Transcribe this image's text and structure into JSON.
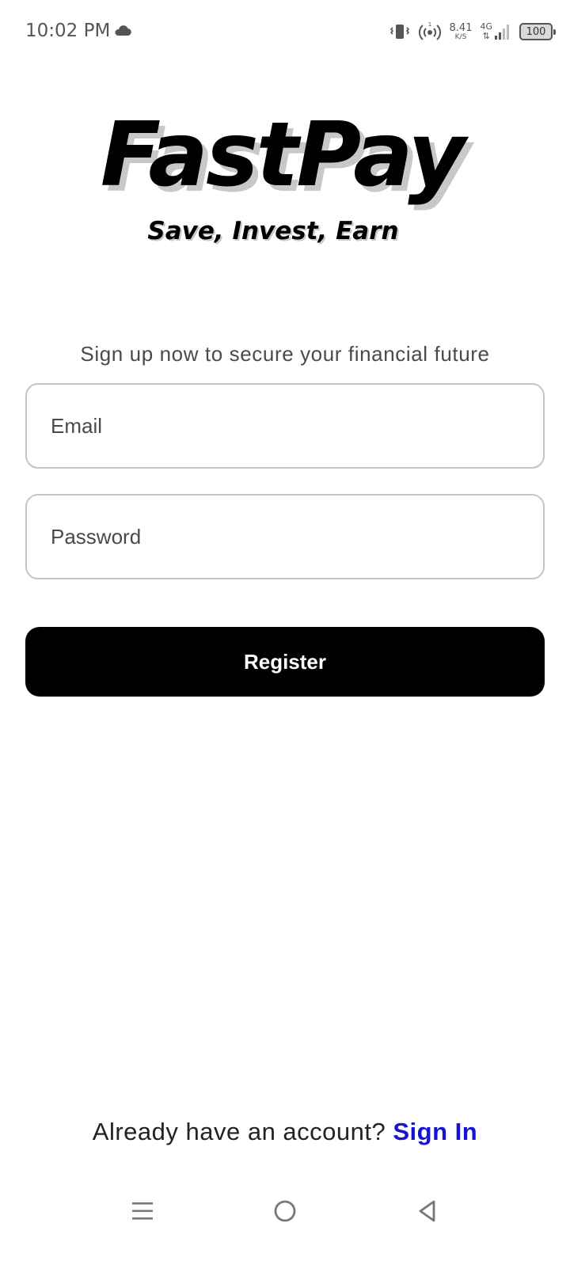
{
  "status_bar": {
    "time": "10:02 PM",
    "net_speed_value": "8.41",
    "net_speed_unit": "K/S",
    "network_type": "4G",
    "battery_level": "100",
    "icons": [
      "cloud-icon",
      "vibrate-icon",
      "hotspot-icon",
      "signal-icon",
      "battery-icon"
    ]
  },
  "logo": {
    "title": "FastPay",
    "tagline": "Save, Invest, Earn"
  },
  "form": {
    "subtitle": "Sign up now to secure your financial future",
    "email_placeholder": "Email",
    "email_value": "",
    "password_placeholder": "Password",
    "password_value": "",
    "register_label": "Register"
  },
  "footer": {
    "prompt": "Already have an account?",
    "signin_label": "Sign In"
  },
  "colors": {
    "button_bg": "#000000",
    "link": "#1414d2",
    "field_border": "#c4c4c4"
  },
  "nav_bar": {
    "icons": [
      "menu-icon",
      "home-icon",
      "back-icon"
    ]
  }
}
